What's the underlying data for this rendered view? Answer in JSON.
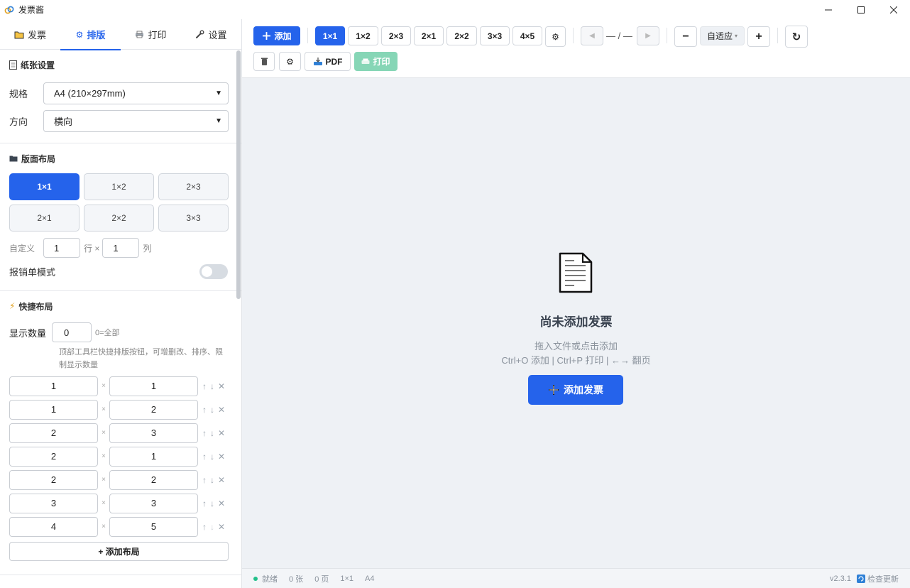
{
  "window": {
    "title": "发票酱",
    "icon": "link-icon"
  },
  "sidebar": {
    "tabs": [
      {
        "label": "发票",
        "icon": "folder-icon"
      },
      {
        "label": "排版",
        "icon": "gear-icon"
      },
      {
        "label": "打印",
        "icon": "printer-icon"
      },
      {
        "label": "设置",
        "icon": "wrench-icon"
      }
    ],
    "paper": {
      "title": "纸张设置",
      "size_label": "规格",
      "size_value": "A4 (210×297mm)",
      "orientation_label": "方向",
      "orientation_value": "横向"
    },
    "layout": {
      "title": "版面布局",
      "options": [
        "1×1",
        "1×2",
        "2×3",
        "2×1",
        "2×2",
        "3×3"
      ],
      "active": "1×1",
      "custom_label": "自定义",
      "rows": "1",
      "rows_unit": "行 ×",
      "cols": "1",
      "cols_unit": "列",
      "reimburse_label": "报销单模式",
      "reimburse_on": false
    },
    "quick": {
      "title": "快捷布局",
      "count_label": "显示数量",
      "count_value": "0",
      "count_hint": "0=全部",
      "desc_line1": "顶部工具栏快捷排版按钮，可增删改、排序、限",
      "desc_line2": "制显示数量",
      "items": [
        {
          "r": "1",
          "c": "1"
        },
        {
          "r": "1",
          "c": "2"
        },
        {
          "r": "2",
          "c": "3"
        },
        {
          "r": "2",
          "c": "1"
        },
        {
          "r": "2",
          "c": "2"
        },
        {
          "r": "3",
          "c": "3"
        },
        {
          "r": "4",
          "c": "5"
        }
      ],
      "add_label": "+ 添加布局"
    }
  },
  "toolbar": {
    "add_label": "添加",
    "layouts": [
      "1×1",
      "1×2",
      "2×3",
      "2×1",
      "2×2",
      "3×3",
      "4×5"
    ],
    "active_layout": "1×1",
    "page_indicator": "— / —",
    "zoom_label": "自适应",
    "pdf_label": "PDF",
    "print_label": "打印"
  },
  "empty": {
    "title": "尚未添加发票",
    "subtitle": "拖入文件或点击添加",
    "shortcuts": "Ctrl+O 添加 | Ctrl+P 打印 | ←→ 翻页",
    "button_label": "添加发票"
  },
  "status": {
    "state": "就绪",
    "count": "0 张",
    "pages": "0 页",
    "layout": "1×1",
    "paper": "A4",
    "version": "v2.3.1",
    "update_label": "检查更新"
  },
  "colors": {
    "accent": "#2563eb",
    "success": "#22c08a",
    "print_disabled": "#86d6b6"
  }
}
